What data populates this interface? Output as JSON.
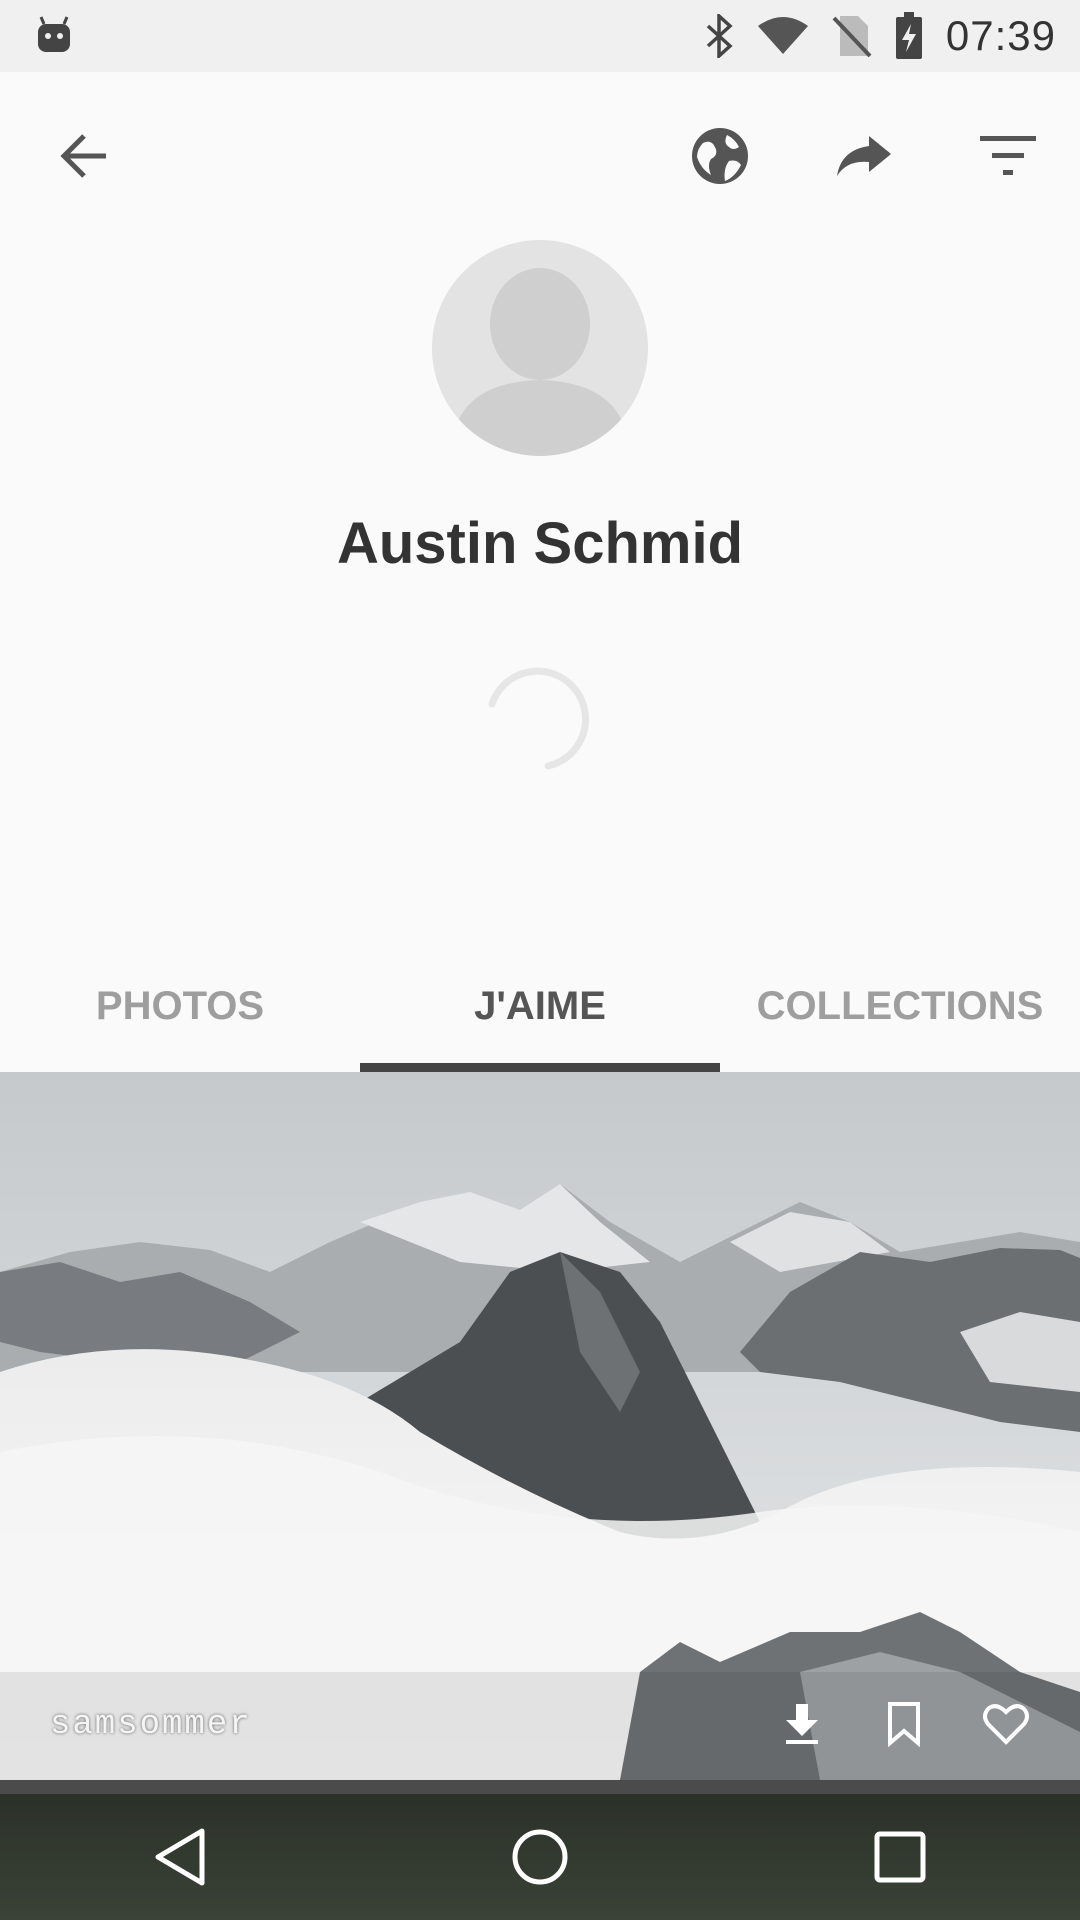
{
  "status_bar": {
    "time": "07:39",
    "icons": [
      "android-debug-icon",
      "bluetooth-icon",
      "wifi-icon",
      "no-sim-icon",
      "battery-charging-icon"
    ]
  },
  "app_bar": {
    "icons": [
      "back-arrow-icon",
      "globe-icon",
      "share-icon",
      "filter-icon"
    ]
  },
  "profile": {
    "name": "Austin Schmid"
  },
  "tabs": [
    {
      "label": "PHOTOS",
      "active": false
    },
    {
      "label": "J'AIME",
      "active": true
    },
    {
      "label": "COLLECTIONS",
      "active": false
    }
  ],
  "photo": {
    "credit": "samsommer",
    "actions": [
      "download-icon",
      "bookmark-icon",
      "heart-icon"
    ]
  },
  "nav_bar": {
    "icons": [
      "back-triangle-icon",
      "home-circle-icon",
      "recents-square-icon"
    ]
  },
  "colors": {
    "background": "#fafafa",
    "status_bar": "#f0f0f0",
    "tab_indicator": "#444444",
    "tab_inactive": "#9e9e9e"
  }
}
